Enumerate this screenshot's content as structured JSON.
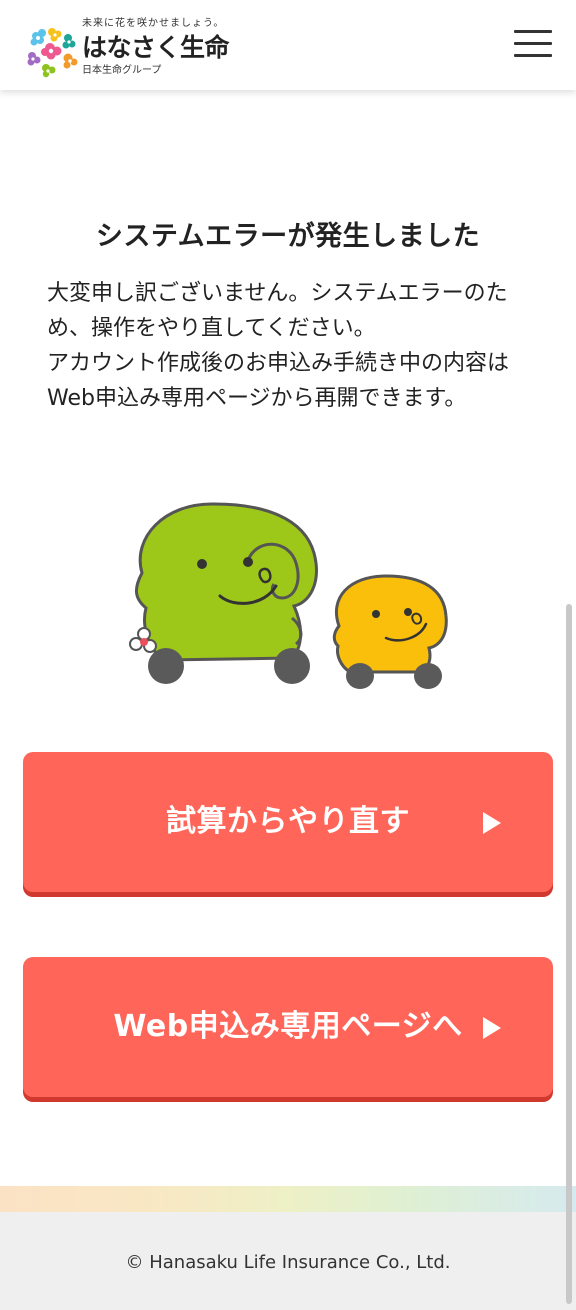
{
  "header": {
    "tagline": "未来に花を咲かせましょう。",
    "company_name": "はなさく生命",
    "group_name": "日本生命グループ",
    "menu_icon": "hamburger-menu-icon"
  },
  "main": {
    "title": "システムエラーが発生しました",
    "message_line1": "大変申し訳ございません。システムエラーのため、操作をやり直してください。",
    "message_line2": "アカウント作成後のお申込み手続き中の内容はWeb申込み専用ページから再開できます。"
  },
  "buttons": {
    "restart_label": "試算からやり直す",
    "web_label": "Web申込み専用ページへ",
    "arrow_icon": "play-arrow-icon"
  },
  "footer": {
    "copyright": "© Hanasaku Life Insurance Co., Ltd."
  },
  "colors": {
    "button": "#ff6559",
    "button_shadow": "#d2392e",
    "character_green": "#9dc81a",
    "character_yellow": "#f9bf0a",
    "footer_bg": "#efefef"
  }
}
